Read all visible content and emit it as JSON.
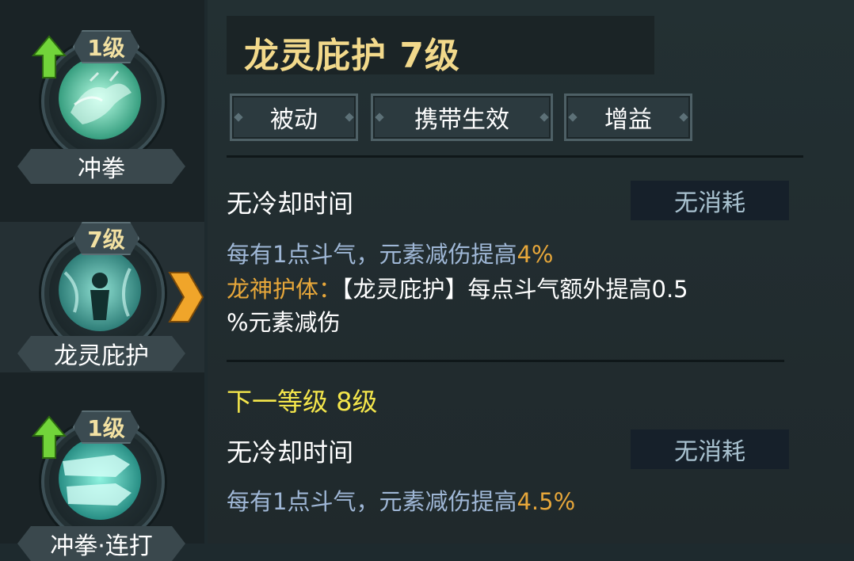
{
  "sidebar": {
    "skills": [
      {
        "level": "1级",
        "name": "冲拳",
        "has_upgrade": true
      },
      {
        "level": "7级",
        "name": "龙灵庇护",
        "has_upgrade": false,
        "selected": true
      },
      {
        "level": "1级",
        "name": "冲拳·连打",
        "has_upgrade": true
      }
    ]
  },
  "detail": {
    "title": "龙灵庇护 7级",
    "tags": [
      "被动",
      "携带生效",
      "增益"
    ],
    "current": {
      "cooldown": "无冷却时间",
      "cost": "无消耗",
      "desc_line1_prefix": "每有1点斗气，元素减伤提高",
      "desc_line1_value": "4%",
      "bonus_label": "龙神护体：",
      "bonus_text_line1": "【龙灵庇护】每点斗气额外提高0.5",
      "bonus_text_line2": "%元素减伤"
    },
    "next": {
      "heading": "下一等级 8级",
      "cooldown": "无冷却时间",
      "cost": "无消耗",
      "desc_prefix": "每有1点斗气，元素减伤提高",
      "desc_value": "4.5%"
    }
  },
  "colors": {
    "title": "#f2d98b",
    "highlight": "#e7a73a",
    "next_level": "#f4e64b",
    "desc": "#9fb7d6"
  }
}
